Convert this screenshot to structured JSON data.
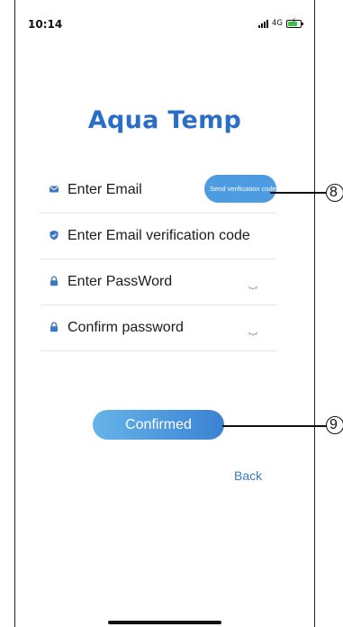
{
  "status_bar": {
    "time": "10:14",
    "network": "4G",
    "icons": [
      "signal-icon",
      "battery-charging-icon"
    ]
  },
  "app": {
    "title": "Aqua Temp",
    "title_color": "#2a6fc5"
  },
  "form": {
    "email": {
      "placeholder": "Enter Email",
      "icon": "mail-icon"
    },
    "send_code_button": "Send verification code",
    "verification": {
      "placeholder": "Enter Email verification code",
      "icon": "shield-check-icon"
    },
    "password": {
      "placeholder": "Enter PassWord",
      "icon": "lock-icon",
      "toggle_icon": "eye-closed-icon"
    },
    "confirm_password": {
      "placeholder": "Confirm password",
      "icon": "lock-icon",
      "toggle_icon": "eye-closed-icon"
    }
  },
  "actions": {
    "confirm_label": "Confirmed",
    "back_label": "Back"
  },
  "callouts": {
    "send_code": "8",
    "confirm": "9"
  },
  "colors": {
    "accent": "#4d9be0",
    "link": "#3a7ac4",
    "icon": "#3a7ac4"
  }
}
